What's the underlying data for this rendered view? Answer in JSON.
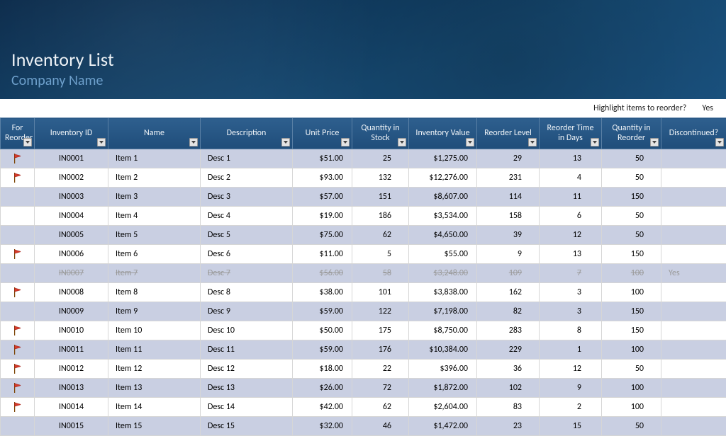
{
  "header": {
    "title": "Inventory List",
    "subtitle": "Company Name"
  },
  "highlight": {
    "label": "Highlight items to reorder?",
    "value": "Yes"
  },
  "columns": [
    "For Reorder",
    "Inventory ID",
    "Name",
    "Description",
    "Unit Price",
    "Quantity in Stock",
    "Inventory Value",
    "Reorder Level",
    "Reorder Time in Days",
    "Quantity in Reorder",
    "Discontinued?"
  ],
  "rows": [
    {
      "flag": true,
      "id": "IN0001",
      "name": "Item 1",
      "desc": "Desc 1",
      "price": "$51.00",
      "qty": "25",
      "value": "$1,275.00",
      "rl": "29",
      "rt": "13",
      "qr": "50",
      "disc": "",
      "discontinued": false
    },
    {
      "flag": true,
      "id": "IN0002",
      "name": "Item 2",
      "desc": "Desc 2",
      "price": "$93.00",
      "qty": "132",
      "value": "$12,276.00",
      "rl": "231",
      "rt": "4",
      "qr": "50",
      "disc": "",
      "discontinued": false
    },
    {
      "flag": false,
      "id": "IN0003",
      "name": "Item 3",
      "desc": "Desc 3",
      "price": "$57.00",
      "qty": "151",
      "value": "$8,607.00",
      "rl": "114",
      "rt": "11",
      "qr": "150",
      "disc": "",
      "discontinued": false
    },
    {
      "flag": false,
      "id": "IN0004",
      "name": "Item 4",
      "desc": "Desc 4",
      "price": "$19.00",
      "qty": "186",
      "value": "$3,534.00",
      "rl": "158",
      "rt": "6",
      "qr": "50",
      "disc": "",
      "discontinued": false
    },
    {
      "flag": false,
      "id": "IN0005",
      "name": "Item 5",
      "desc": "Desc 5",
      "price": "$75.00",
      "qty": "62",
      "value": "$4,650.00",
      "rl": "39",
      "rt": "12",
      "qr": "50",
      "disc": "",
      "discontinued": false
    },
    {
      "flag": true,
      "id": "IN0006",
      "name": "Item 6",
      "desc": "Desc 6",
      "price": "$11.00",
      "qty": "5",
      "value": "$55.00",
      "rl": "9",
      "rt": "13",
      "qr": "150",
      "disc": "",
      "discontinued": false
    },
    {
      "flag": false,
      "id": "IN0007",
      "name": "Item 7",
      "desc": "Desc 7",
      "price": "$56.00",
      "qty": "58",
      "value": "$3,248.00",
      "rl": "109",
      "rt": "7",
      "qr": "100",
      "disc": "Yes",
      "discontinued": true
    },
    {
      "flag": true,
      "id": "IN0008",
      "name": "Item 8",
      "desc": "Desc 8",
      "price": "$38.00",
      "qty": "101",
      "value": "$3,838.00",
      "rl": "162",
      "rt": "3",
      "qr": "100",
      "disc": "",
      "discontinued": false
    },
    {
      "flag": false,
      "id": "IN0009",
      "name": "Item 9",
      "desc": "Desc 9",
      "price": "$59.00",
      "qty": "122",
      "value": "$7,198.00",
      "rl": "82",
      "rt": "3",
      "qr": "150",
      "disc": "",
      "discontinued": false
    },
    {
      "flag": true,
      "id": "IN0010",
      "name": "Item 10",
      "desc": "Desc 10",
      "price": "$50.00",
      "qty": "175",
      "value": "$8,750.00",
      "rl": "283",
      "rt": "8",
      "qr": "150",
      "disc": "",
      "discontinued": false
    },
    {
      "flag": true,
      "id": "IN0011",
      "name": "Item 11",
      "desc": "Desc 11",
      "price": "$59.00",
      "qty": "176",
      "value": "$10,384.00",
      "rl": "229",
      "rt": "1",
      "qr": "100",
      "disc": "",
      "discontinued": false
    },
    {
      "flag": true,
      "id": "IN0012",
      "name": "Item 12",
      "desc": "Desc 12",
      "price": "$18.00",
      "qty": "22",
      "value": "$396.00",
      "rl": "36",
      "rt": "12",
      "qr": "50",
      "disc": "",
      "discontinued": false
    },
    {
      "flag": true,
      "id": "IN0013",
      "name": "Item 13",
      "desc": "Desc 13",
      "price": "$26.00",
      "qty": "72",
      "value": "$1,872.00",
      "rl": "102",
      "rt": "9",
      "qr": "100",
      "disc": "",
      "discontinued": false
    },
    {
      "flag": true,
      "id": "IN0014",
      "name": "Item 14",
      "desc": "Desc 14",
      "price": "$42.00",
      "qty": "62",
      "value": "$2,604.00",
      "rl": "83",
      "rt": "2",
      "qr": "100",
      "disc": "",
      "discontinued": false
    },
    {
      "flag": false,
      "id": "IN0015",
      "name": "Item 15",
      "desc": "Desc 15",
      "price": "$32.00",
      "qty": "46",
      "value": "$1,472.00",
      "rl": "23",
      "rt": "15",
      "qr": "50",
      "disc": "",
      "discontinued": false
    }
  ]
}
